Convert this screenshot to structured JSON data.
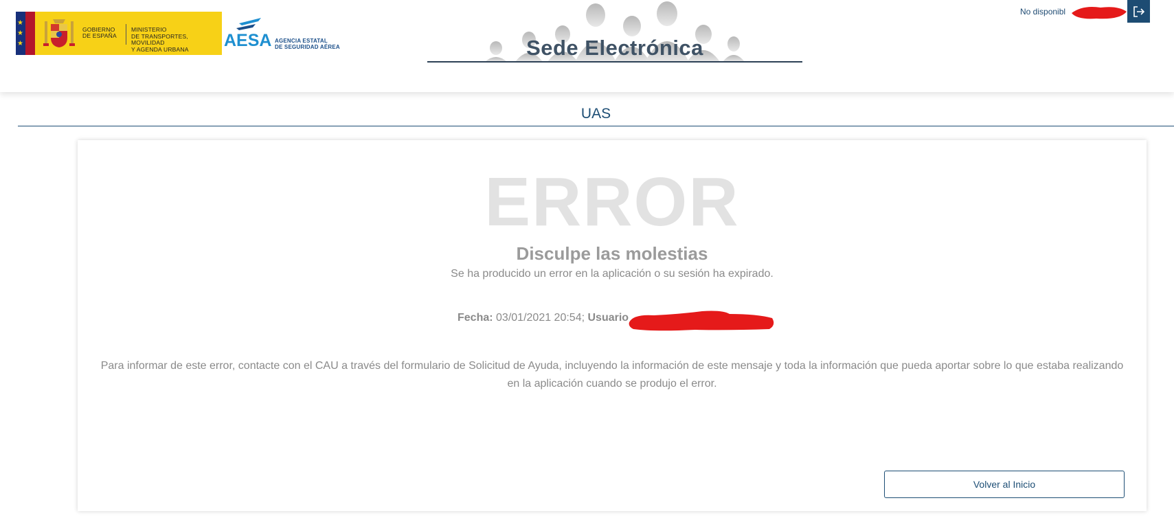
{
  "header": {
    "gov_logo": {
      "line1": "GOBIERNO",
      "line2": "DE ESPAÑA"
    },
    "ministry": {
      "line1": "MINISTERIO",
      "line2": "DE TRANSPORTES, MOVILIDAD",
      "line3": "Y AGENDA URBANA"
    },
    "aesa": {
      "word": "AESA",
      "line1": "AGENCIA ESTATAL",
      "line2": "DE SEGURIDAD AÉREA"
    },
    "site_title": "Sede Electrónica",
    "user_label": "No disponibl",
    "logout_icon": "logout-icon"
  },
  "section": {
    "title": "UAS"
  },
  "error": {
    "big": "ERROR",
    "heading": "Disculpe las molestias",
    "subtitle": "Se ha producido un error en la aplicación o su sesión ha expirado.",
    "fecha_label": "Fecha:",
    "fecha_value": "03/01/2021 20:54;",
    "usuario_label": "Usuario",
    "info": "Para informar de este error, contacte con el CAU a través del formulario de Solicitud de Ayuda, incluyendo la información de este mensaje y toda la información que pueda aportar sobre lo que estaba realizando en la aplicación cuando se produjo el error."
  },
  "buttons": {
    "home": "Volver al Inicio"
  },
  "colors": {
    "primary": "#1c4d74",
    "gov_yellow": "#f7d117",
    "aesa_blue": "#1e8fd0",
    "redaction": "#e51a1a"
  }
}
